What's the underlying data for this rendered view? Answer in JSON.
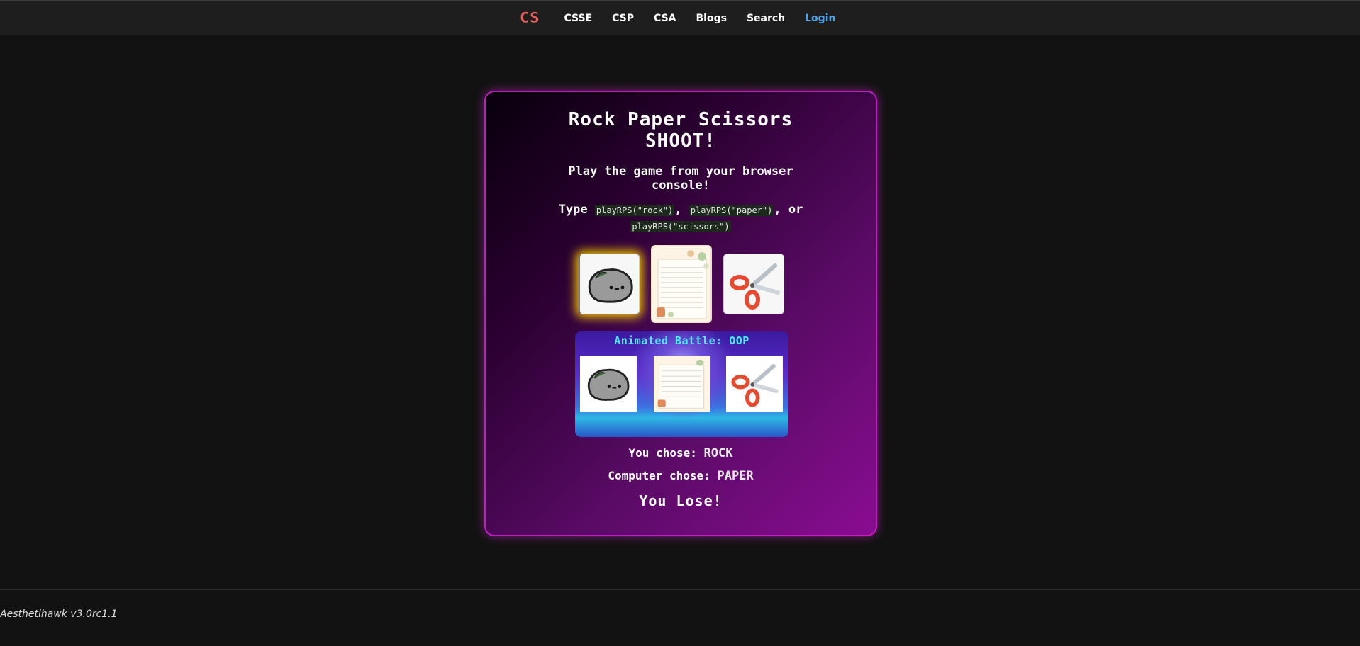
{
  "nav": {
    "logo": "CS",
    "links": [
      "CSSE",
      "CSP",
      "CSA",
      "Blogs",
      "Search",
      "Login"
    ]
  },
  "game": {
    "title_line1": "Rock Paper Scissors",
    "title_line2": "SHOOT!",
    "subtitle_line1": "Play the game from your browser",
    "subtitle_line2": "console!",
    "type_word": "Type",
    "cmd_rock": "playRPS(\"rock\")",
    "cmd_paper": "playRPS(\"paper\")",
    "cmd_scissors": "playRPS(\"scissors\")",
    "sep1": ",",
    "sep2": ", or",
    "battle_title": "Animated Battle: OOP",
    "you_label": "You chose:",
    "you_value": "ROCK",
    "computer_label": "Computer chose:",
    "computer_value": "PAPER",
    "outcome": "You Lose!",
    "choices": [
      {
        "name": "rock",
        "icon": "rock-icon",
        "selected": true
      },
      {
        "name": "paper",
        "icon": "paper-icon",
        "selected": false
      },
      {
        "name": "scissors",
        "icon": "scissors-icon",
        "selected": false
      }
    ]
  },
  "footer": {
    "text": "Aesthetihawk v3.0rc1.1"
  },
  "colors": {
    "accent": "#c01ec0",
    "logo": "#e85d5d",
    "login": "#4aa3f0",
    "highlight": "#f2c200",
    "battle_title": "#4fe9ff"
  }
}
